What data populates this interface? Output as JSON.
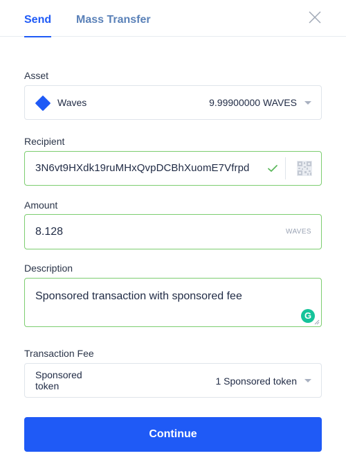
{
  "tabs": {
    "send": "Send",
    "mass_transfer": "Mass Transfer"
  },
  "asset": {
    "label": "Asset",
    "name": "Waves",
    "balance": "9.99900000 WAVES",
    "icon": "waves-diamond-icon",
    "icon_color": "#1f5af6"
  },
  "recipient": {
    "label": "Recipient",
    "value": "3N6vt9HXdk19ruMHxQvpDCBhXuomE7Vfrpd",
    "valid": true
  },
  "amount": {
    "label": "Amount",
    "value": "8.128",
    "unit": "WAVES"
  },
  "description": {
    "label": "Description",
    "value": "Sponsored transaction with sponsored fee"
  },
  "fee": {
    "label": "Transaction Fee",
    "asset_name": "Sponsored token",
    "value": "1 Sponsored token"
  },
  "continue_label": "Continue",
  "colors": {
    "accent": "#1f5af6",
    "valid_border": "#7ccd6f",
    "grammarly": "#15c39a"
  }
}
